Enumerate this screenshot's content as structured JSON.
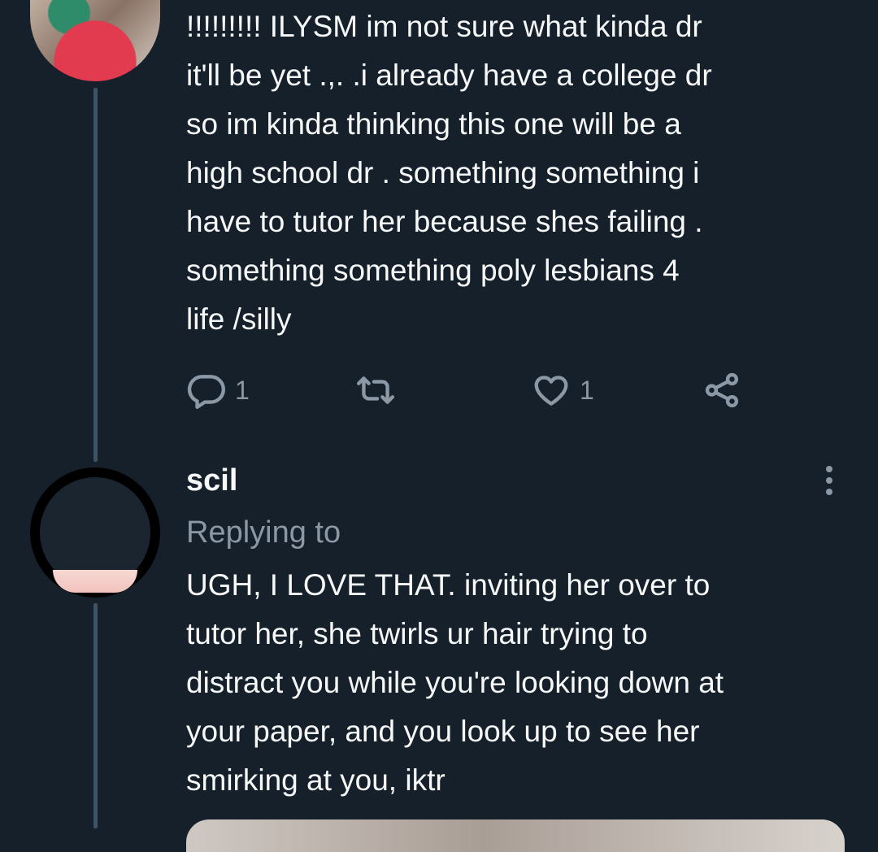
{
  "tweet_1": {
    "text": "!!!!!!!!! ILYSM im not sure what kinda dr\nit'll be yet .,. .i already have a college dr\nso im kinda thinking this one will be a\nhigh school dr . something something i\nhave to tutor her because shes failing .\nsomething something poly lesbians 4\nlife /silly",
    "actions": {
      "reply_icon": "comment-icon",
      "reply_count": "1",
      "retweet_icon": "retweet-icon",
      "like_icon": "heart-icon",
      "like_count": "1",
      "share_icon": "share-icon"
    }
  },
  "tweet_2": {
    "display_name": "scil",
    "replying_to": "Replying to",
    "text": "UGH, I LOVE THAT. inviting her over to\ntutor her, she twirls ur hair trying to\ndistract you while you're looking down at\nyour paper, and you look up to see her\nsmirking at you, iktr",
    "more_icon": "more-vertical-icon"
  },
  "colors": {
    "background": "#15202b",
    "text_primary": "#f7f9f9",
    "text_secondary": "#8b98a5",
    "thread_line": "#3d5466"
  }
}
